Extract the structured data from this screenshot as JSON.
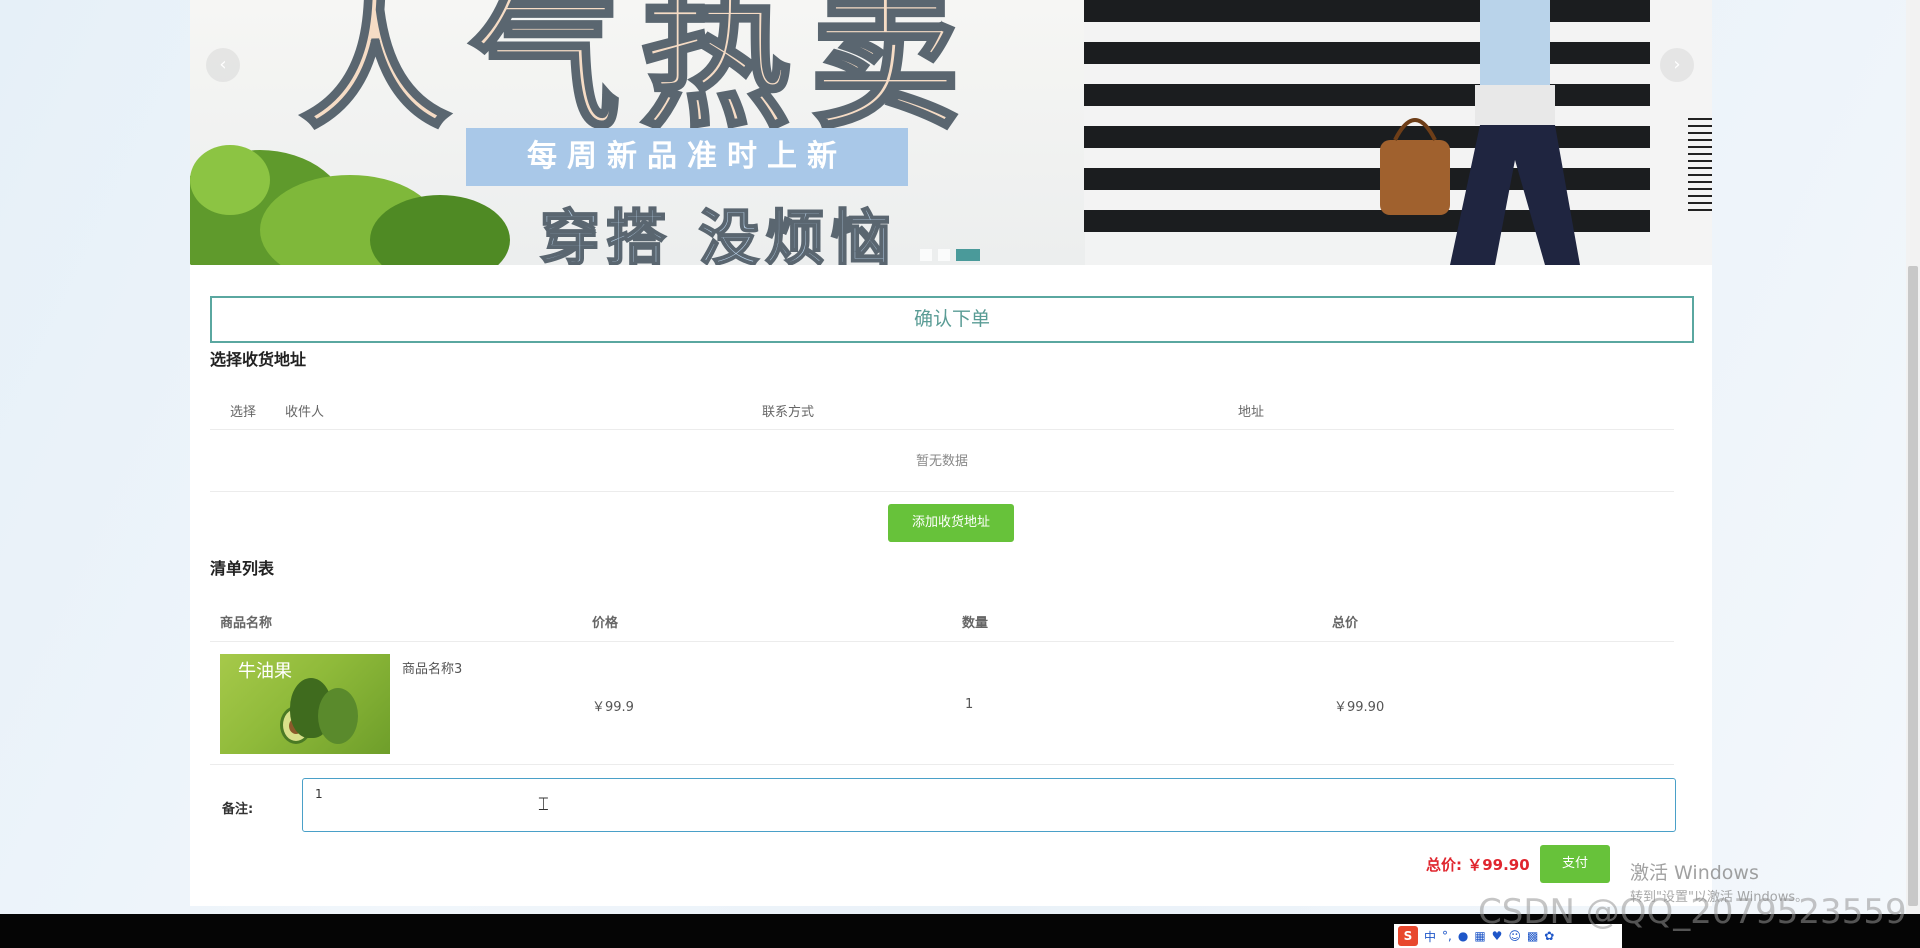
{
  "banner": {
    "big_text": "人气热卖",
    "sub_text": "每周新品准时上新",
    "slogan": "穿搭 没烦恼",
    "prev_icon": "chevron-left-icon",
    "next_icon": "chevron-right-icon",
    "active_slide": 3,
    "slide_count": 3
  },
  "page": {
    "confirm_title": "确认下单"
  },
  "address": {
    "section_title": "选择收货地址",
    "headers": {
      "select": "选择",
      "recipient": "收件人",
      "contact": "联系方式",
      "address": "地址"
    },
    "empty_text": "暂无数据",
    "add_button": "添加收货地址"
  },
  "cart": {
    "section_title": "清单列表",
    "headers": {
      "name": "商品名称",
      "price": "价格",
      "quantity": "数量",
      "total": "总价"
    },
    "items": [
      {
        "name": "商品名称3",
        "price": "￥99.9",
        "quantity": "1",
        "total": "￥99.90",
        "thumb_text": "牛油果"
      }
    ]
  },
  "remark": {
    "label": "备注:",
    "value": "1"
  },
  "summary": {
    "total_text": "总价: ￥99.90",
    "pay_button": "支付"
  },
  "system": {
    "activate_title": "激活 Windows",
    "activate_sub": "转到\"设置\"以激活 Windows。",
    "watermark": "CSDN @QQ_2079523559",
    "ime_label": "中"
  },
  "colors": {
    "accent": "#5aa7a0",
    "button_green": "#67c23a",
    "price_red": "#e0262e"
  }
}
